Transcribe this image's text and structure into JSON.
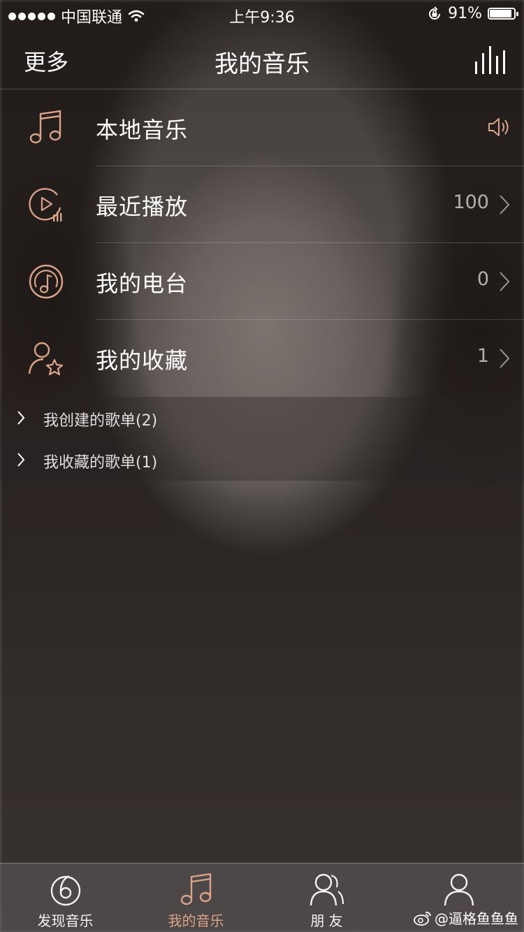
{
  "status_bar": {
    "carrier": "中国联通",
    "time": "上午9:36",
    "battery_percent": "91%",
    "battery_level": 0.91
  },
  "nav": {
    "left_label": "更多",
    "title": "我的音乐",
    "right_icon": "equalizer-bars-icon"
  },
  "menu": [
    {
      "label": "本地音乐",
      "count": "",
      "icon": "music-note-icon",
      "trailing": "speaker-icon"
    },
    {
      "label": "最近播放",
      "count": "100",
      "icon": "recent-play-icon",
      "trailing": "chevron-right-icon"
    },
    {
      "label": "我的电台",
      "count": "0",
      "icon": "radio-icon",
      "trailing": "chevron-right-icon"
    },
    {
      "label": "我的收藏",
      "count": "1",
      "icon": "user-star-icon",
      "trailing": "chevron-right-icon"
    }
  ],
  "playlists": [
    {
      "label": "我创建的歌单(2)"
    },
    {
      "label": "我收藏的歌单(1)"
    }
  ],
  "tabs": [
    {
      "label": "发现音乐",
      "icon": "discover-icon",
      "active": false
    },
    {
      "label": "我的音乐",
      "icon": "music-note-icon",
      "active": true
    },
    {
      "label": "朋 友",
      "icon": "friends-icon",
      "active": false
    },
    {
      "label": "",
      "icon": "user-icon",
      "active": false
    }
  ],
  "watermark": {
    "text": "@逼格鱼鱼鱼"
  },
  "colors": {
    "accent": "#d9a48a",
    "text": "#ffffff",
    "muted": "#b9b3b0"
  }
}
